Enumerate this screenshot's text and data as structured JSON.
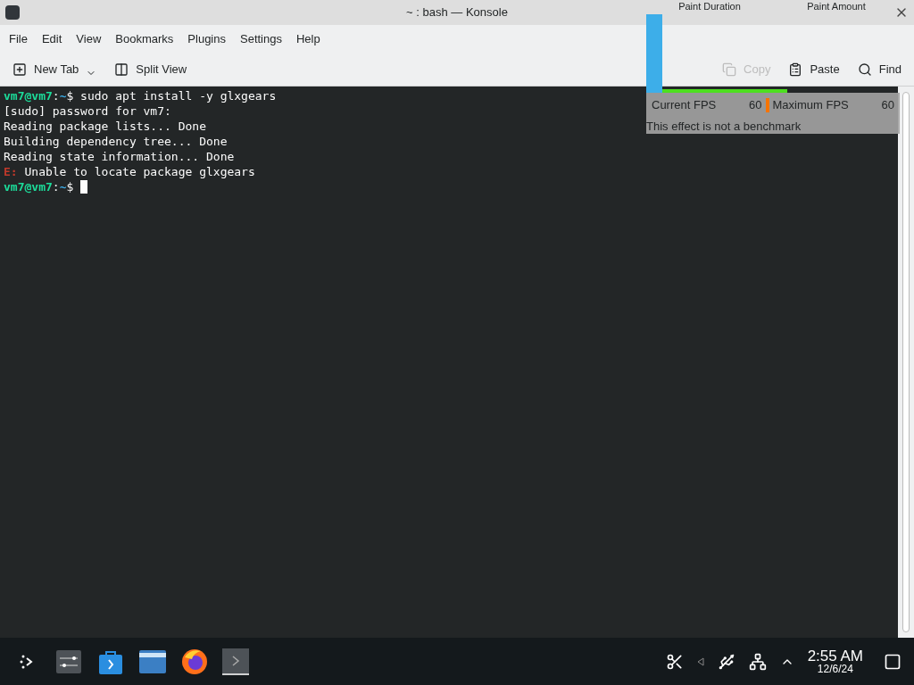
{
  "window": {
    "title": "~ : bash — Konsole"
  },
  "menu": [
    "File",
    "Edit",
    "View",
    "Bookmarks",
    "Plugins",
    "Settings",
    "Help"
  ],
  "toolbar": [
    {
      "kind": "new-tab",
      "label": "New Tab",
      "disabled": false
    },
    {
      "kind": "split",
      "label": "Split View",
      "disabled": false
    }
  ],
  "toolbar_right": [
    {
      "kind": "copy",
      "label": "Copy",
      "disabled": true
    },
    {
      "kind": "paste",
      "label": "Paste",
      "disabled": false
    },
    {
      "kind": "find",
      "label": "Find",
      "disabled": false
    }
  ],
  "terminal": {
    "lines": [
      {
        "kind": "prompt",
        "user": "vm7@vm7",
        "sep": ":",
        "path": "~",
        "sign": "$",
        "command": "sudo apt install -y glxgears"
      },
      {
        "kind": "text",
        "text": "[sudo] password for vm7:"
      },
      {
        "kind": "text",
        "text": "Reading package lists... Done"
      },
      {
        "kind": "text",
        "text": "Building dependency tree... Done"
      },
      {
        "kind": "text",
        "text": "Reading state information... Done"
      },
      {
        "kind": "error",
        "tag": "E:",
        "text": "Unable to locate package glxgears"
      },
      {
        "kind": "prompt",
        "user": "vm7@vm7",
        "sep": ":",
        "path": "~",
        "sign": "$",
        "cursor": true
      }
    ]
  },
  "fps_overlay": {
    "headers": [
      "Paint Duration",
      "Paint Amount"
    ],
    "current_label": "Current FPS",
    "current_value": "60",
    "max_label": "Maximum FPS",
    "max_value": "60",
    "note": "This effect is not a benchmark"
  },
  "taskbar": {
    "time": "2:55 AM",
    "date": "12/6/24"
  }
}
